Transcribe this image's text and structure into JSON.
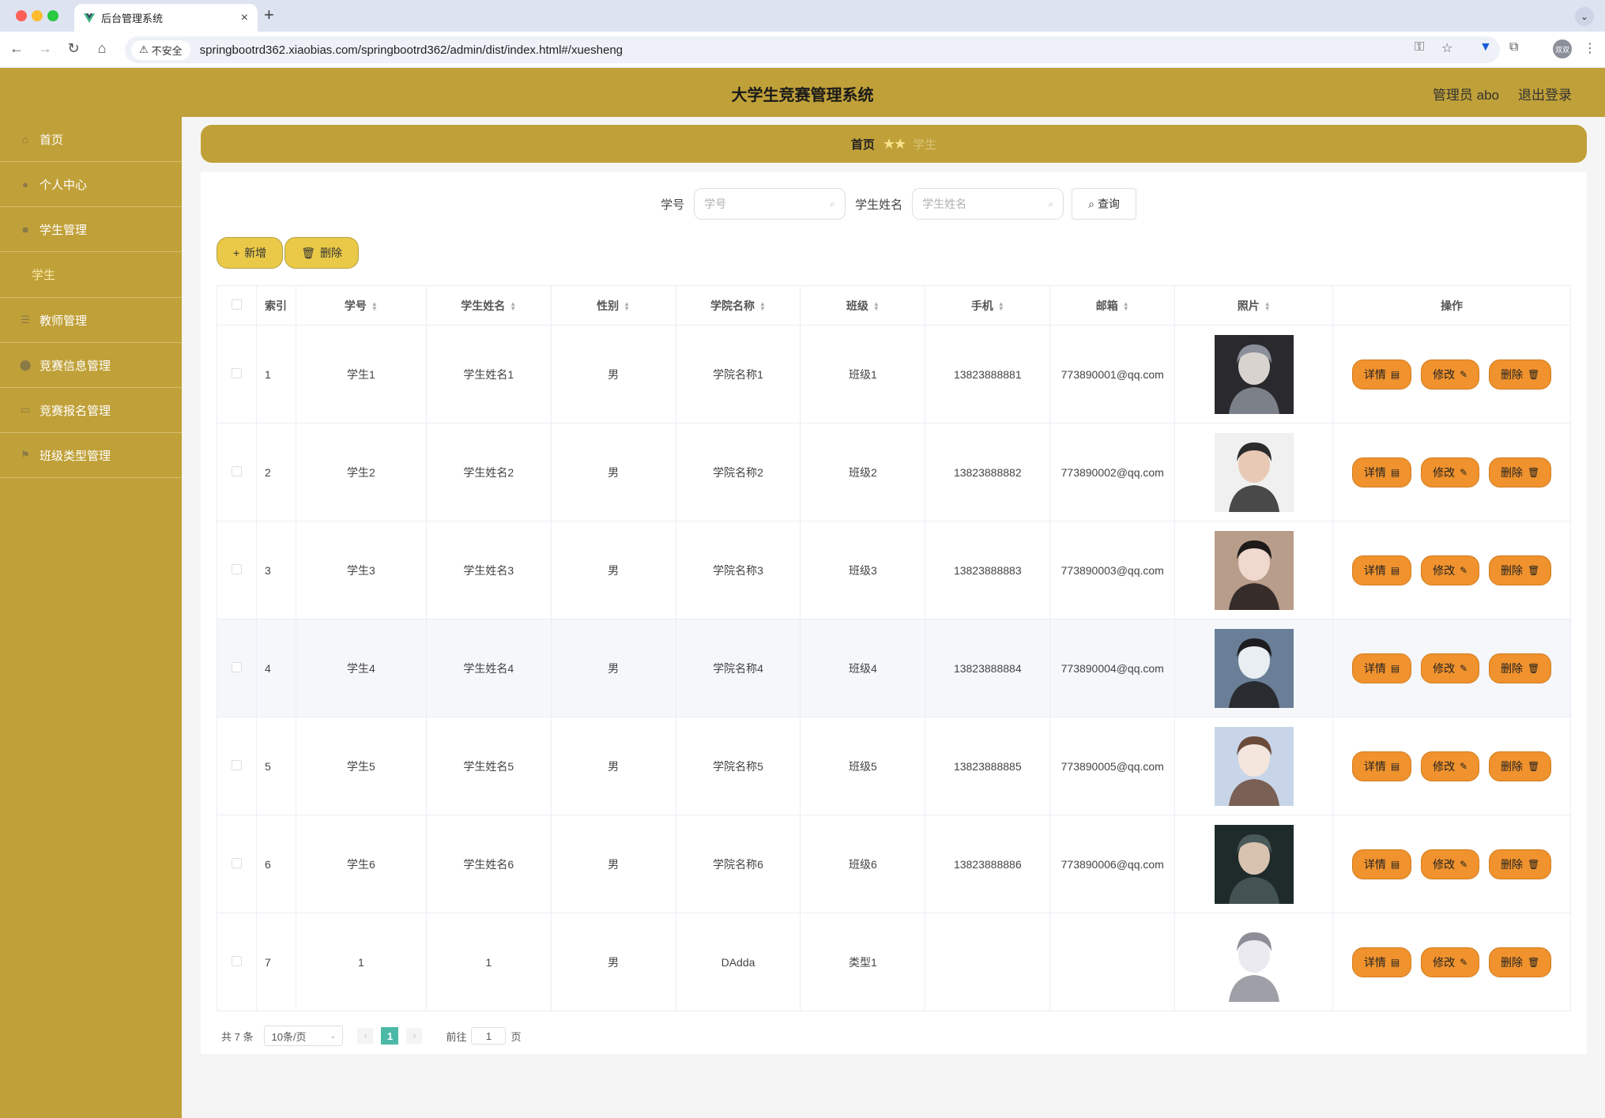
{
  "browser": {
    "tab_title": "后台管理系统",
    "insecure_label": "不安全",
    "url": "springbootrd362.xiaobias.com/springbootrd362/admin/dist/index.html#/xuesheng",
    "avatar_text": "双双"
  },
  "header": {
    "title": "大学生竞赛管理系统",
    "user": "管理员 abo",
    "logout": "退出登录"
  },
  "sidebar": {
    "items": [
      {
        "label": "首页",
        "icon": "home-icon"
      },
      {
        "label": "个人中心",
        "icon": "user-icon"
      },
      {
        "label": "学生管理",
        "icon": "folder-icon"
      },
      {
        "label": "学生",
        "sub": true
      },
      {
        "label": "教师管理",
        "icon": "list-icon"
      },
      {
        "label": "竞赛信息管理",
        "icon": "location-icon"
      },
      {
        "label": "竞赛报名管理",
        "icon": "ticket-icon"
      },
      {
        "label": "班级类型管理",
        "icon": "flag-icon"
      }
    ]
  },
  "breadcrumb": {
    "home": "首页",
    "current": "学生"
  },
  "search": {
    "student_no_label": "学号",
    "student_no_placeholder": "学号",
    "student_name_label": "学生姓名",
    "student_name_placeholder": "学生姓名",
    "query_label": "查询"
  },
  "actions": {
    "add_label": "新增",
    "delete_label": "删除"
  },
  "table": {
    "headers": [
      "索引",
      "学号",
      "学生姓名",
      "性别",
      "学院名称",
      "班级",
      "手机",
      "邮箱",
      "照片",
      "操作"
    ],
    "rows": [
      {
        "index": "1",
        "no": "学生1",
        "name": "学生姓名1",
        "gender": "男",
        "college": "学院名称1",
        "class": "班级1",
        "phone": "13823888881",
        "email": "773890001@qq.com"
      },
      {
        "index": "2",
        "no": "学生2",
        "name": "学生姓名2",
        "gender": "男",
        "college": "学院名称2",
        "class": "班级2",
        "phone": "13823888882",
        "email": "773890002@qq.com"
      },
      {
        "index": "3",
        "no": "学生3",
        "name": "学生姓名3",
        "gender": "男",
        "college": "学院名称3",
        "class": "班级3",
        "phone": "13823888883",
        "email": "773890003@qq.com"
      },
      {
        "index": "4",
        "no": "学生4",
        "name": "学生姓名4",
        "gender": "男",
        "college": "学院名称4",
        "class": "班级4",
        "phone": "13823888884",
        "email": "773890004@qq.com"
      },
      {
        "index": "5",
        "no": "学生5",
        "name": "学生姓名5",
        "gender": "男",
        "college": "学院名称5",
        "class": "班级5",
        "phone": "13823888885",
        "email": "773890005@qq.com"
      },
      {
        "index": "6",
        "no": "学生6",
        "name": "学生姓名6",
        "gender": "男",
        "college": "学院名称6",
        "class": "班级6",
        "phone": "13823888886",
        "email": "773890006@qq.com"
      },
      {
        "index": "7",
        "no": "1",
        "name": "1",
        "gender": "男",
        "college": "DAdda",
        "class": "类型1",
        "phone": "",
        "email": ""
      }
    ],
    "op_detail": "详情",
    "op_edit": "修改",
    "op_delete": "删除"
  },
  "pagination": {
    "total": "共 7 条",
    "page_size": "10条/页",
    "current_page": "1",
    "goto_label": "前往",
    "goto_value": "1",
    "page_suffix": "页"
  },
  "colors": {
    "primary": "#c0a038",
    "op_button": "#f0922d",
    "add_button": "#e9c947",
    "pager_active": "#4cb8a6"
  }
}
